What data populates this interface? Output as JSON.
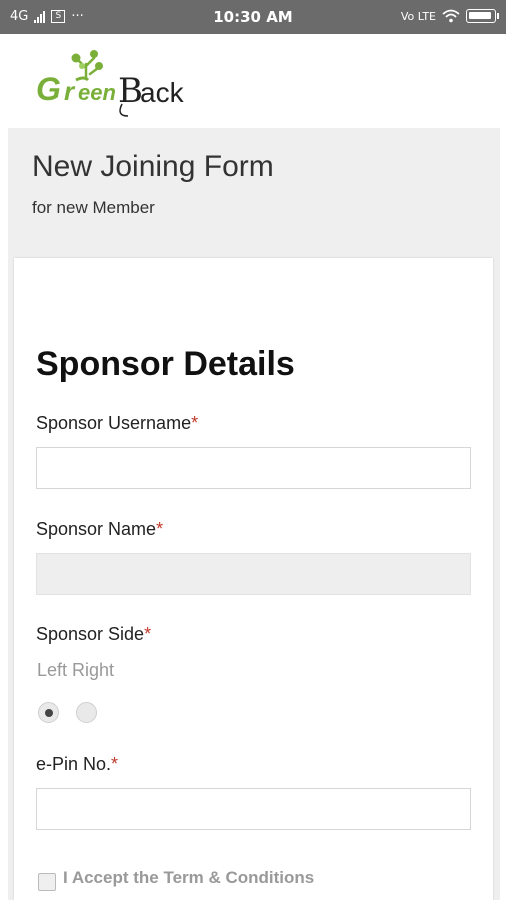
{
  "status_bar": {
    "network": "4G",
    "sim_icon": "S",
    "dots": "···",
    "time": "10:30 AM",
    "volte": "Vo LTE"
  },
  "logo": {
    "alt": "GreenBack",
    "text_green": "Green",
    "text_dark": "Back"
  },
  "header": {
    "title": "New Joining Form",
    "subtitle": "for new Member"
  },
  "section": {
    "title": "Sponsor Details"
  },
  "fields": {
    "sponsor_username": {
      "label": "Sponsor Username",
      "required_mark": "*",
      "value": ""
    },
    "sponsor_name": {
      "label": "Sponsor Name",
      "required_mark": "*",
      "value": ""
    },
    "sponsor_side": {
      "label": "Sponsor Side",
      "required_mark": "*",
      "options_text": "Left Right",
      "selected": "Left"
    },
    "epin": {
      "label": "e-Pin No.",
      "required_mark": "*",
      "value": ""
    }
  },
  "terms": {
    "label": "I Accept the Term & Conditions",
    "checked": false
  },
  "colors": {
    "status_bar": "#6b6b6b",
    "brand_green": "#7ab03a",
    "required": "#c0392b"
  }
}
